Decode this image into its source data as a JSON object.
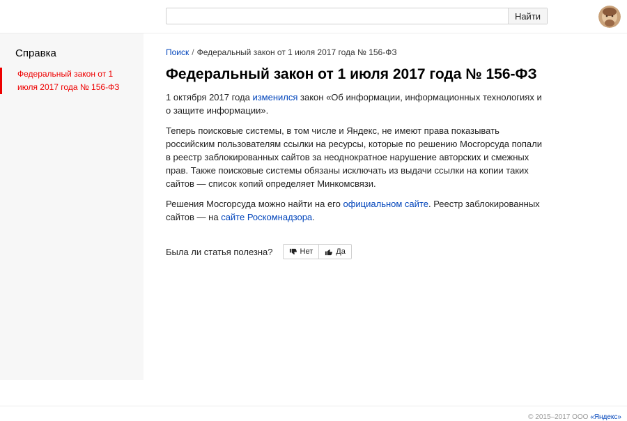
{
  "header": {
    "search_value": "",
    "search_button_label": "Найти"
  },
  "sidebar": {
    "title": "Справка",
    "items": [
      {
        "label": "Федеральный закон от 1 июля 2017 года № 156-ФЗ",
        "active": true
      }
    ]
  },
  "breadcrumb": {
    "root": "Поиск",
    "separator": "/",
    "current": "Федеральный закон от 1 июля 2017 года № 156-ФЗ"
  },
  "article": {
    "title": "Федеральный закон от 1 июля 2017 года № 156-ФЗ",
    "p1_before": "1 октября 2017 года ",
    "p1_link": "изменился",
    "p1_after": " закон «Об информации, информационных технологиях и о защите информации».",
    "p2": "Теперь поисковые системы, в том числе и Яндекс, не имеют права показывать российским пользователям ссылки на ресурсы, которые по решению Мосгорсуда попали в реестр заблокированных сайтов за неоднократное нарушение авторских и смежных прав. Также поисковые системы обязаны исключать из выдачи ссылки на копии таких сайтов — список копий определяет Минкомсвязи.",
    "p3_before": "Решения Мосгорсуда можно найти на его ",
    "p3_link1": "официальном сайте",
    "p3_middle": ". Реестр заблокированных сайтов — на ",
    "p3_link2": "сайте Роскомнадзора",
    "p3_after": "."
  },
  "feedback": {
    "question": "Была ли статья полезна?",
    "no_label": "Нет",
    "yes_label": "Да"
  },
  "footer": {
    "copyright": "© 2015–2017 ООО ",
    "company": "«Яндекс»"
  },
  "colors": {
    "accent_red": "#ee0000",
    "link_blue": "#0044bb",
    "sidebar_bg": "#f7f7f7"
  },
  "icons": {
    "dislike": "thumbs-down-icon",
    "like": "thumbs-up-icon"
  }
}
